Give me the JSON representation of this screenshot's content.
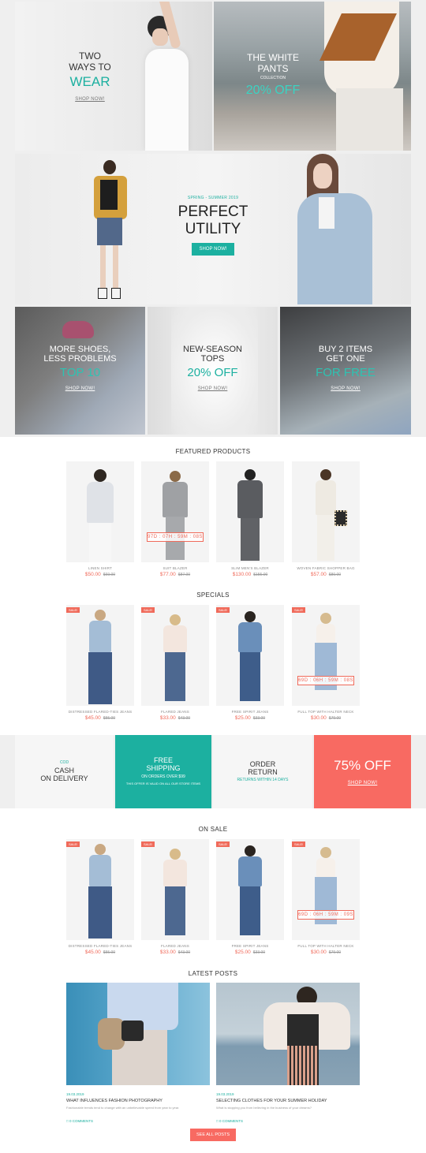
{
  "banners": {
    "two_ways": {
      "line1": "TWO",
      "line2": "WAYS TO",
      "accent": "WEAR",
      "link": "SHOP NOW!"
    },
    "white_pants": {
      "line1": "THE WHITE",
      "line2": "PANTS",
      "sub": "COLLECTION",
      "accent": "20% OFF"
    },
    "perfect_utility": {
      "season": "SPRING - SUMMER 2019",
      "line1": "PERFECT",
      "line2": "UTILITY",
      "button": "SHOP NOW!"
    },
    "shoes": {
      "line1": "MORE SHOES,",
      "line2": "LESS PROBLEMS",
      "accent": "TOP 10",
      "link": "SHOP NOW!"
    },
    "tops": {
      "line1": "NEW-SEASON",
      "line2": "TOPS",
      "accent": "20% OFF",
      "link": "SHOP NOW!"
    },
    "buy2": {
      "line1": "BUY 2 ITEMS",
      "line2": "GET ONE",
      "accent": "FOR FREE",
      "link": "SHOP NOW!"
    }
  },
  "featured": {
    "title": "FEATURED PRODUCTS",
    "items": [
      {
        "name": "LINEN SHIRT",
        "price": "$50.00",
        "old": "$69.00"
      },
      {
        "name": "SUIT BLAZER",
        "price": "$77.00",
        "old": "$87.00",
        "timer": "97D : 07H : 59M : 08S"
      },
      {
        "name": "SLIM MEN'S BLAZER",
        "price": "$130.00",
        "old": "$155.00"
      },
      {
        "name": "WOVEN FABRIC SHOPPER BAG",
        "price": "$57.00",
        "old": "$80.00"
      }
    ]
  },
  "specials": {
    "title": "SPECIALS",
    "sale_label": "SALE!",
    "items": [
      {
        "name": "DISTRESSED FLARED-TIES JEANS",
        "price": "$45.00",
        "old": "$55.00"
      },
      {
        "name": "FLARED JEANS",
        "price": "$33.00",
        "old": "$43.00"
      },
      {
        "name": "FREE SPIRIT JEANS",
        "price": "$25.00",
        "old": "$33.00"
      },
      {
        "name": "FULL TOP WITH HALTER NECK",
        "price": "$30.00",
        "old": "$79.00",
        "timer": "69D : 06H : 59M : 08S"
      }
    ]
  },
  "features": {
    "cod": {
      "tag": "COD",
      "line1": "CASH",
      "line2": "ON DELIVERY"
    },
    "shipping": {
      "line1": "FREE",
      "line2": "SHIPPING",
      "sub": "ON ORDERS OVER $99",
      "note": "THIS OFFER IS VALID ON ALL OUR STORE ITEMS"
    },
    "return": {
      "line1": "ORDER",
      "line2": "RETURN",
      "sub": "RETURNS WITHIN 14 DAYS"
    },
    "promo": {
      "accent": "75% OFF",
      "link": "SHOP NOW!"
    }
  },
  "onsale": {
    "title": "ON SALE",
    "sale_label": "SALE!",
    "items": [
      {
        "name": "DISTRESSED FLARED-TIES JEANS",
        "price": "$45.00",
        "old": "$55.00"
      },
      {
        "name": "FLARED JEANS",
        "price": "$33.00",
        "old": "$43.00"
      },
      {
        "name": "FREE SPIRIT JEANS",
        "price": "$25.00",
        "old": "$33.00"
      },
      {
        "name": "FULL TOP WITH HALTER NECK",
        "price": "$30.00",
        "old": "$79.00",
        "timer": "69D : 06H : 59M : 09S"
      }
    ]
  },
  "posts": {
    "title": "LATEST POSTS",
    "items": [
      {
        "date": "19.03.2019",
        "title": "WHAT INFLUENCES FASHION PHOTOGRAPHY",
        "excerpt": "Fashionable trends tend to change with an unbelievable speed from year to year.",
        "comments": "0 COMMENTS"
      },
      {
        "date": "19.03.2019",
        "title": "SELECTING CLOTHES FOR YOUR SUMMER HOLIDAY",
        "excerpt": "What is stopping you from believing in the business of your dreams?",
        "comments": "0 COMMENTS"
      }
    ],
    "see_all": "SEE ALL POSTS"
  },
  "colors": {
    "accent": "#1cb0a0",
    "sale": "#f06a5a",
    "background": "#efefef"
  }
}
